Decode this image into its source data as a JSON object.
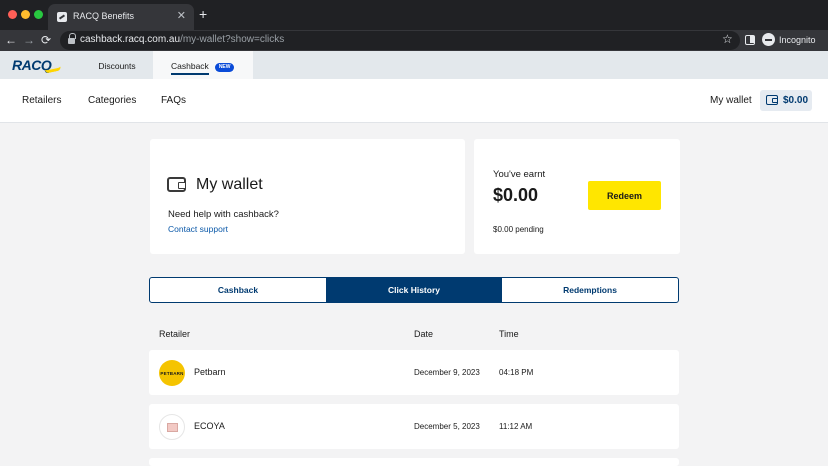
{
  "browser": {
    "tab_title": "RACQ Benefits",
    "tab_close": "✕",
    "new_tab": "+",
    "back": "←",
    "forward": "→",
    "reload": "⟳",
    "url_host": "cashback.racq.com.au",
    "url_path": "/my-wallet?show=clicks",
    "star": "☆",
    "profile_label": "Incognito"
  },
  "site": {
    "logo": "RACQ",
    "top_tabs": {
      "discounts": "Discounts",
      "cashback": "Cashback",
      "new_badge": "NEW"
    },
    "nav": {
      "retailers": "Retailers",
      "categories": "Categories",
      "faqs": "FAQs",
      "my_wallet": "My wallet",
      "wallet_amount": "$0.00"
    }
  },
  "wallet_card": {
    "title": "My wallet",
    "help_text": "Need help with cashback?",
    "contact_link": "Contact support"
  },
  "earnt_card": {
    "label": "You've earnt",
    "amount": "$0.00",
    "redeem_label": "Redeem",
    "pending": "$0.00 pending"
  },
  "tabs": [
    "Cashback",
    "Click History",
    "Redemptions"
  ],
  "active_tab": "Click History",
  "table": {
    "headers": {
      "retailer": "Retailer",
      "date": "Date",
      "time": "Time"
    },
    "rows": [
      {
        "retailer": "Petbarn",
        "logo_text": "PETBARN",
        "date": "December 9, 2023",
        "time": "04:18 PM"
      },
      {
        "retailer": "ECOYA",
        "date": "December 5, 2023",
        "time": "11:12 AM"
      }
    ]
  },
  "colors": {
    "brand_navy": "#003a70",
    "accent_yellow": "#ffe600",
    "link_blue": "#0a58a8",
    "badge_blue": "#0a4bd8"
  }
}
